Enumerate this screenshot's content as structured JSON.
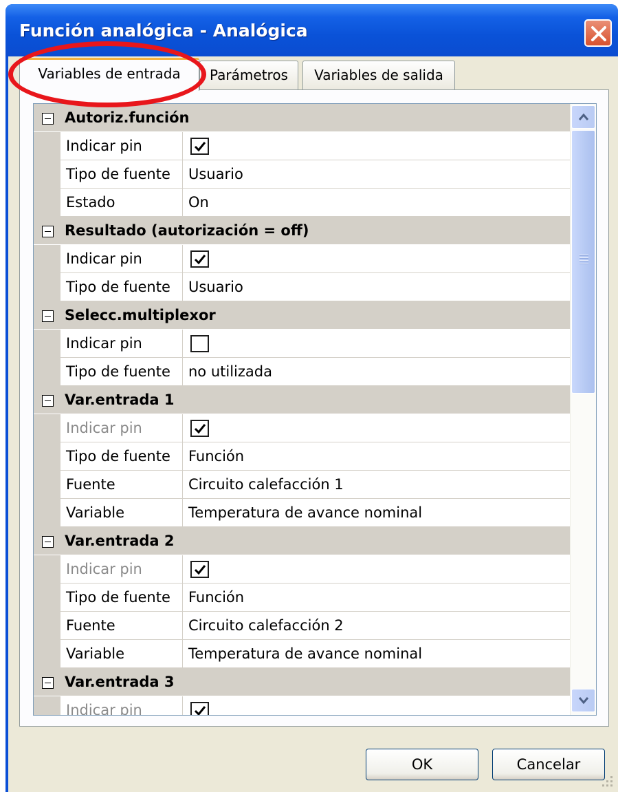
{
  "window": {
    "title": "Función analógica - Analógica",
    "close_icon": "close-x-icon"
  },
  "tabs": [
    {
      "label": "Variables de entrada",
      "active": true
    },
    {
      "label": "Parámetros",
      "active": false
    },
    {
      "label": "Variables de salida",
      "active": false
    }
  ],
  "grid": {
    "categories": [
      {
        "label": "Autoriz.función",
        "rows": [
          {
            "name": "Indicar pin",
            "checked": true,
            "disabled": false
          },
          {
            "name": "Tipo de fuente",
            "value": "Usuario"
          },
          {
            "name": "Estado",
            "value": "On"
          }
        ]
      },
      {
        "label": "Resultado (autorización = off)",
        "rows": [
          {
            "name": "Indicar pin",
            "checked": true,
            "disabled": false
          },
          {
            "name": "Tipo de fuente",
            "value": "Usuario"
          }
        ]
      },
      {
        "label": "Selecc.multiplexor",
        "rows": [
          {
            "name": "Indicar pin",
            "checked": false,
            "disabled": false
          },
          {
            "name": "Tipo de fuente",
            "value": "no utilizada"
          }
        ]
      },
      {
        "label": "Var.entrada 1",
        "rows": [
          {
            "name": "Indicar pin",
            "checked": true,
            "disabled": true
          },
          {
            "name": "Tipo de fuente",
            "value": "Función"
          },
          {
            "name": "Fuente",
            "value": "Circuito calefacción 1"
          },
          {
            "name": "Variable",
            "value": "Temperatura de avance nominal"
          }
        ]
      },
      {
        "label": "Var.entrada 2",
        "rows": [
          {
            "name": "Indicar pin",
            "checked": true,
            "disabled": true
          },
          {
            "name": "Tipo de fuente",
            "value": "Función"
          },
          {
            "name": "Fuente",
            "value": "Circuito calefacción 2"
          },
          {
            "name": "Variable",
            "value": "Temperatura de avance nominal"
          }
        ]
      },
      {
        "label": "Var.entrada 3",
        "rows": [
          {
            "name": "Indicar pin",
            "checked": true,
            "disabled": true
          }
        ]
      }
    ]
  },
  "buttons": {
    "ok_label": "OK",
    "cancel_label": "Cancelar"
  },
  "colors": {
    "title_bar": "#0a52d8",
    "highlight": "#e8161b",
    "category_bg": "#d4d0c8",
    "active_tab_accent": "#f4b341"
  }
}
